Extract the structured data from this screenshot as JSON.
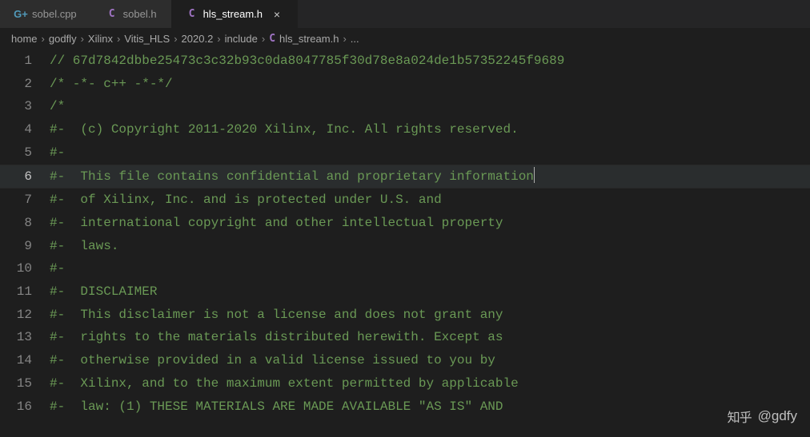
{
  "tabs": [
    {
      "icon": "cpp",
      "iconGlyph": "G+",
      "label": "sobel.cpp",
      "active": false,
      "close": false
    },
    {
      "icon": "c",
      "iconGlyph": "C",
      "label": "sobel.h",
      "active": false,
      "close": false
    },
    {
      "icon": "c",
      "iconGlyph": "C",
      "label": "hls_stream.h",
      "active": true,
      "close": true
    }
  ],
  "breadcrumb": {
    "items": [
      "home",
      "godfly",
      "Xilinx",
      "Vitis_HLS",
      "2020.2",
      "include"
    ],
    "fileIcon": "C",
    "file": "hls_stream.h",
    "trailing": "..."
  },
  "lines": [
    {
      "n": 1,
      "text": "// 67d7842dbbe25473c3c32b93c0da8047785f30d78e8a024de1b57352245f9689"
    },
    {
      "n": 2,
      "text": "/* -*- c++ -*-*/"
    },
    {
      "n": 3,
      "text": "/*"
    },
    {
      "n": 4,
      "text": "#-  (c) Copyright 2011-2020 Xilinx, Inc. All rights reserved."
    },
    {
      "n": 5,
      "text": "#-"
    },
    {
      "n": 6,
      "text": "#-  This file contains confidential and proprietary information",
      "current": true
    },
    {
      "n": 7,
      "text": "#-  of Xilinx, Inc. and is protected under U.S. and"
    },
    {
      "n": 8,
      "text": "#-  international copyright and other intellectual property"
    },
    {
      "n": 9,
      "text": "#-  laws."
    },
    {
      "n": 10,
      "text": "#-"
    },
    {
      "n": 11,
      "text": "#-  DISCLAIMER"
    },
    {
      "n": 12,
      "text": "#-  This disclaimer is not a license and does not grant any"
    },
    {
      "n": 13,
      "text": "#-  rights to the materials distributed herewith. Except as"
    },
    {
      "n": 14,
      "text": "#-  otherwise provided in a valid license issued to you by"
    },
    {
      "n": 15,
      "text": "#-  Xilinx, and to the maximum extent permitted by applicable"
    },
    {
      "n": 16,
      "text": "#-  law: (1) THESE MATERIALS ARE MADE AVAILABLE \"AS IS\" AND"
    }
  ],
  "watermark": {
    "icon": "知乎",
    "text": "@gdfy"
  }
}
